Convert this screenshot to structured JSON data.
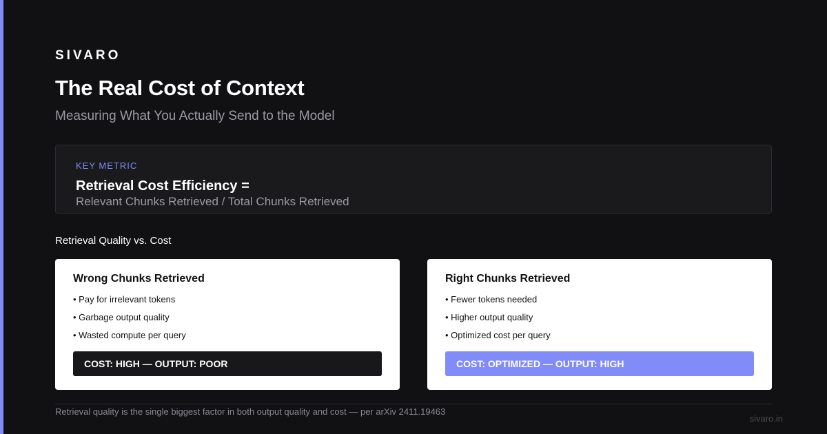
{
  "colors": {
    "background": "#111113",
    "accent": "#818cf8",
    "card": "#ffffff",
    "dark_bar": "#18181b"
  },
  "brand": "SIVARO",
  "title": "The Real Cost of Context",
  "subtitle": "Measuring What You Actually Send to the Model",
  "metric": {
    "label": "KEY METRIC",
    "formula": "Retrieval Cost Efficiency =",
    "definition": "Relevant Chunks Retrieved / Total Chunks Retrieved"
  },
  "section_label": "Retrieval Quality vs. Cost",
  "cards": [
    {
      "title": "Wrong Chunks Retrieved",
      "items": [
        "• Pay for irrelevant tokens",
        "• Garbage output quality",
        "• Wasted compute per query"
      ],
      "verdict": "COST: HIGH — OUTPUT: POOR"
    },
    {
      "title": "Right Chunks Retrieved",
      "items": [
        "• Fewer tokens needed",
        "• Higher output quality",
        "• Optimized cost per query"
      ],
      "verdict": "COST: OPTIMIZED — OUTPUT: HIGH"
    }
  ],
  "footer": {
    "note": "Retrieval quality is the single biggest factor in both output quality and cost — per arXiv 2411.19463",
    "domain": "sivaro.in"
  }
}
